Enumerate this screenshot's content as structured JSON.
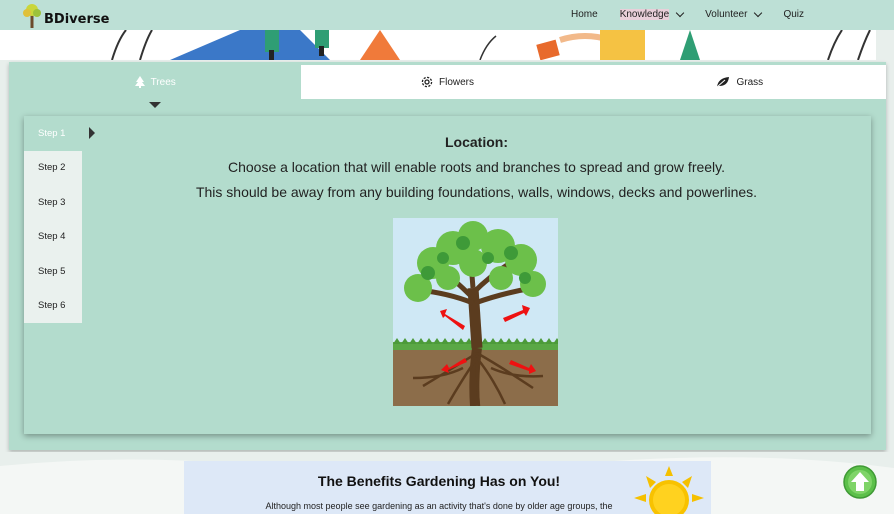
{
  "header": {
    "logo_text": "BDiverse",
    "nav": [
      {
        "label": "Home",
        "has_dropdown": false
      },
      {
        "label": "Knowledge",
        "has_dropdown": true
      },
      {
        "label": "Volunteer",
        "has_dropdown": true
      },
      {
        "label": "Quiz",
        "has_dropdown": false
      }
    ]
  },
  "tabs": [
    {
      "label": "Trees",
      "icon": "tree-icon",
      "active": true
    },
    {
      "label": "Flowers",
      "icon": "flower-icon",
      "active": false
    },
    {
      "label": "Grass",
      "icon": "leaf-icon",
      "active": false
    }
  ],
  "steps": [
    {
      "label": "Step 1",
      "active": true
    },
    {
      "label": "Step 2",
      "active": false
    },
    {
      "label": "Step 3",
      "active": false
    },
    {
      "label": "Step 4",
      "active": false
    },
    {
      "label": "Step 5",
      "active": false
    },
    {
      "label": "Step 6",
      "active": false
    }
  ],
  "step_content": {
    "title": "Location:",
    "line1": "Choose a location that will enable roots and branches to spread and grow freely.",
    "line2": "This should be away from any building foundations, walls, windows, decks and powerlines."
  },
  "benefits": {
    "title": "The Benefits Gardening Has on You!",
    "text": "Although most people see gardening as an activity that's done by older age groups, the"
  },
  "colors": {
    "header_bg": "#bde0d6",
    "panel_bg": "#b3dccd",
    "arrow_red": "#ee1111",
    "scroll_green": "#5cc04a"
  }
}
